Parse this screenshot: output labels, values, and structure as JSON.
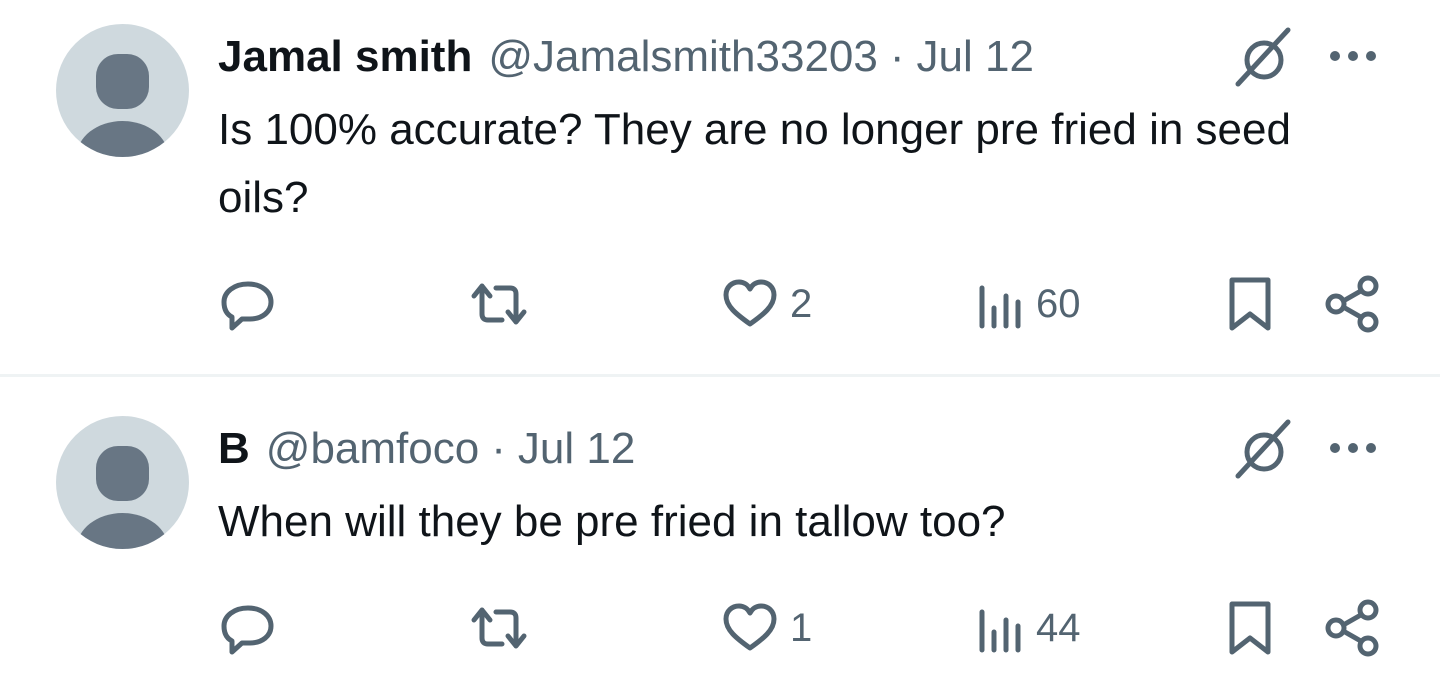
{
  "posts": [
    {
      "display_name": "Jamal smith",
      "handle": "@Jamalsmith33203",
      "separator": "·",
      "date": "Jul 12",
      "text": "Is 100% accurate? They are no longer pre fried in seed oils?",
      "likes": "2",
      "views": "60"
    },
    {
      "display_name": "B",
      "handle": "@bamfoco",
      "separator": "·",
      "date": "Jul 12",
      "text": "When will they be pre fried in tallow too?",
      "likes": "1",
      "views": "44"
    }
  ],
  "icons": {
    "avatar": "default-avatar-icon",
    "grok": "grok-icon",
    "more": "more-icon",
    "reply": "reply-icon",
    "repost": "repost-icon",
    "like": "heart-icon",
    "views": "views-icon",
    "bookmark": "bookmark-icon",
    "share": "share-icon"
  },
  "colors": {
    "text_primary": "#0f1419",
    "text_secondary": "#536471",
    "avatar_bg": "#cfd9de",
    "avatar_fg": "#687684",
    "divider": "#eff3f4"
  }
}
